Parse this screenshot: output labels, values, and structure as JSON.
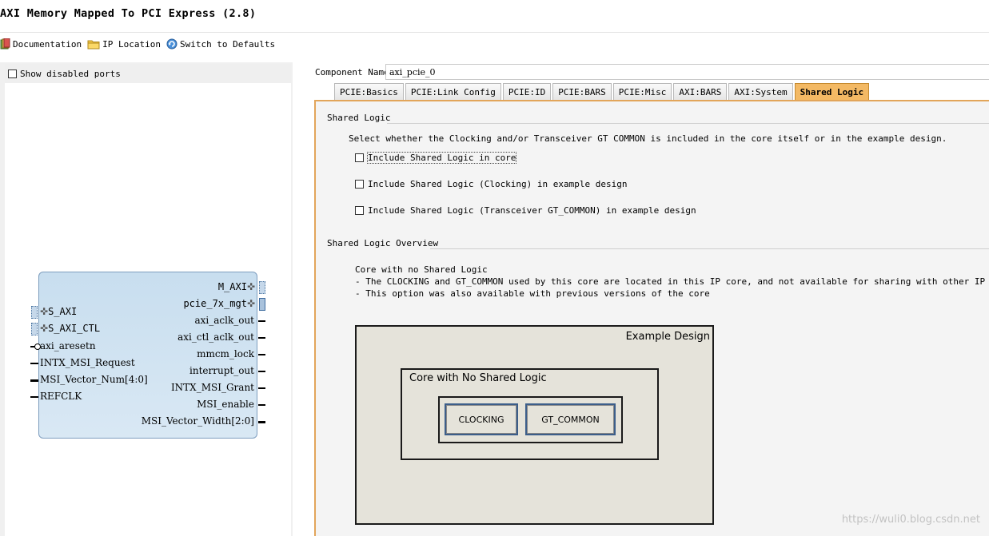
{
  "window": {
    "title": "AXI Memory Mapped To PCI Express (2.8)"
  },
  "toolbar": {
    "documentation": "Documentation",
    "ip_location": "IP Location",
    "switch_defaults": "Switch to Defaults"
  },
  "left_pane": {
    "show_disabled_ports": "Show disabled ports",
    "show_disabled_checked": false,
    "symbol": {
      "left_ports": [
        "S_AXI",
        "S_AXI_CTL",
        "axi_aresetn",
        "INTX_MSI_Request",
        "MSI_Vector_Num[4:0]",
        "REFCLK"
      ],
      "right_ports": [
        "M_AXI",
        "pcie_7x_mgt",
        "axi_aclk_out",
        "axi_ctl_aclk_out",
        "mmcm_lock",
        "interrupt_out",
        "INTX_MSI_Grant",
        "MSI_enable",
        "MSI_Vector_Width[2:0]"
      ]
    }
  },
  "component": {
    "label": "Component Name",
    "value": "axi_pcie_0"
  },
  "tabs": [
    "PCIE:Basics",
    "PCIE:Link Config",
    "PCIE:ID",
    "PCIE:BARS",
    "PCIE:Misc",
    "AXI:BARS",
    "AXI:System",
    "Shared Logic"
  ],
  "active_tab": "Shared Logic",
  "shared_logic": {
    "section_title": "Shared Logic",
    "description": "Select whether the Clocking and/or Transceiver GT COMMON is included in the core itself or in the example design.",
    "options": [
      {
        "label": "Include Shared Logic in core",
        "checked": false
      },
      {
        "label": "Include Shared Logic (Clocking) in example design",
        "checked": false
      },
      {
        "label": "Include Shared Logic (Transceiver GT_COMMON) in example design",
        "checked": false
      }
    ]
  },
  "overview": {
    "section_title": "Shared Logic Overview",
    "lines": [
      "Core with no Shared Logic",
      "- The CLOCKING and GT_COMMON used by this core are located in this IP core, and not available for sharing with other IP core",
      "- This option was also available with previous versions of the core"
    ],
    "diagram": {
      "outer_label": "Example Design",
      "core_label": "Core with No Shared Logic",
      "block1": "CLOCKING",
      "block2": "GT_COMMON"
    }
  },
  "watermark": "https://wuli0.blog.csdn.net",
  "colors": {
    "active_tab": "#f3b964",
    "panel_border": "#e2a55a",
    "symbol_fill": "#c8deef"
  }
}
